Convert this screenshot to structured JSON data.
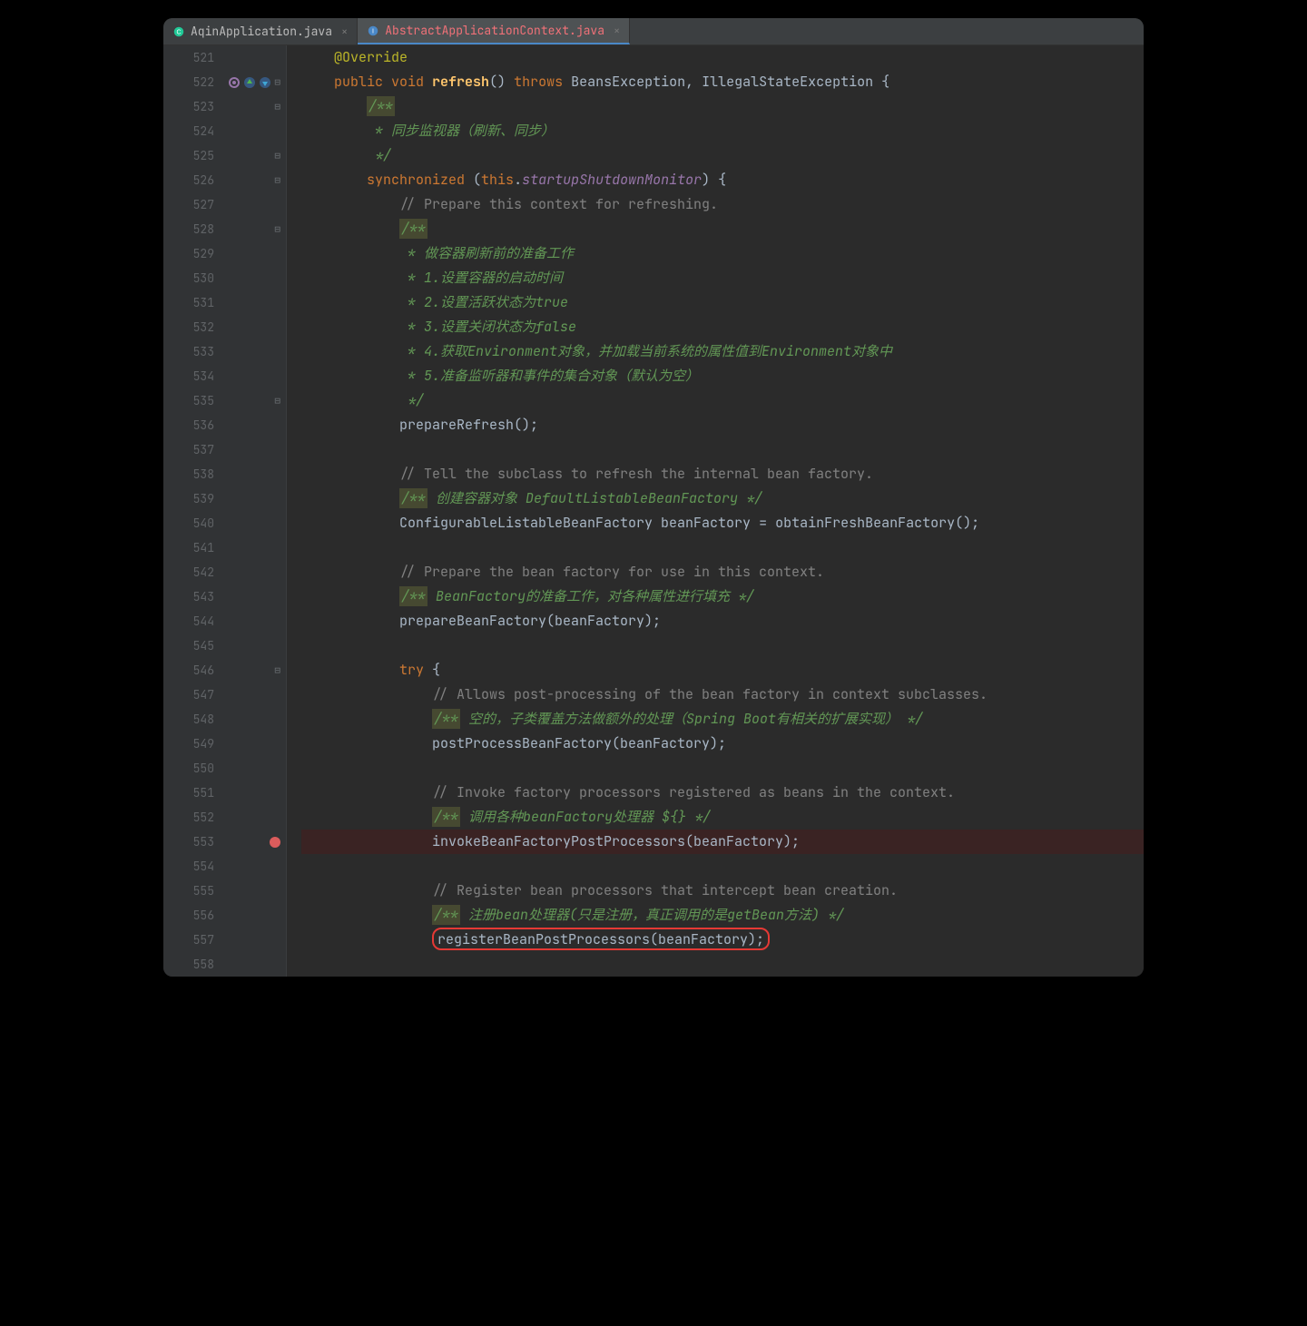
{
  "tabs": [
    {
      "file": "AqinApplication.java",
      "active": false,
      "iconColor": "#20c997"
    },
    {
      "file": "AbstractApplicationContext.java",
      "active": true,
      "iconColor": "#4a88c7"
    }
  ],
  "startLine": 521,
  "lines": [
    {
      "n": 521,
      "indent": 1,
      "t": "ann",
      "text": "@Override",
      "fold": ""
    },
    {
      "n": 522,
      "indent": 1,
      "t": "sig",
      "parts": {
        "kw1": "public",
        "kw2": "void",
        "name": "refresh",
        "throws": "throws",
        "e1": "BeansException",
        "e2": "IllegalStateException"
      },
      "gutterIcons": true,
      "fold": "⊟"
    },
    {
      "n": 523,
      "indent": 2,
      "t": "jdoc-hl",
      "text": "/**",
      "fold": "⊟"
    },
    {
      "n": 524,
      "indent": 2,
      "t": "jdoc",
      "text": " * 同步监视器（刷新、同步）"
    },
    {
      "n": 525,
      "indent": 2,
      "t": "jdoc",
      "text": " */",
      "fold": "⊟"
    },
    {
      "n": 526,
      "indent": 2,
      "t": "sync",
      "parts": {
        "kw": "synchronized",
        "this": "this",
        "mon": "startupShutdownMonitor"
      },
      "fold": "⊟"
    },
    {
      "n": 527,
      "indent": 3,
      "t": "com",
      "text": "// Prepare this context for refreshing."
    },
    {
      "n": 528,
      "indent": 3,
      "t": "jdoc-hl",
      "text": "/**",
      "fold": "⊟"
    },
    {
      "n": 529,
      "indent": 3,
      "t": "jdoc",
      "text": " * 做容器刷新前的准备工作"
    },
    {
      "n": 530,
      "indent": 3,
      "t": "jdoc",
      "text": " * 1.设置容器的启动时间"
    },
    {
      "n": 531,
      "indent": 3,
      "t": "jdoc",
      "text": " * 2.设置活跃状态为true"
    },
    {
      "n": 532,
      "indent": 3,
      "t": "jdoc",
      "text": " * 3.设置关闭状态为false"
    },
    {
      "n": 533,
      "indent": 3,
      "t": "jdoc",
      "text": " * 4.获取Environment对象，并加载当前系统的属性值到Environment对象中"
    },
    {
      "n": 534,
      "indent": 3,
      "t": "jdoc",
      "text": " * 5.准备监听器和事件的集合对象（默认为空）"
    },
    {
      "n": 535,
      "indent": 3,
      "t": "jdoc",
      "text": " */",
      "fold": "⊟"
    },
    {
      "n": 536,
      "indent": 3,
      "t": "call",
      "parts": {
        "name": "prepareRefresh",
        "args": ""
      }
    },
    {
      "n": 537,
      "indent": 3,
      "t": "blank",
      "text": ""
    },
    {
      "n": 538,
      "indent": 3,
      "t": "com",
      "text": "// Tell the subclass to refresh the internal bean factory."
    },
    {
      "n": 539,
      "indent": 3,
      "t": "jdoc-inline",
      "text": " 创建容器对象 DefaultListableBeanFactory "
    },
    {
      "n": 540,
      "indent": 3,
      "t": "decl",
      "parts": {
        "type": "ConfigurableListableBeanFactory",
        "var": "beanFactory",
        "rhs": "obtainFreshBeanFactory"
      }
    },
    {
      "n": 541,
      "indent": 3,
      "t": "blank",
      "text": ""
    },
    {
      "n": 542,
      "indent": 3,
      "t": "com",
      "text": "// Prepare the bean factory for use in this context."
    },
    {
      "n": 543,
      "indent": 3,
      "t": "jdoc-inline",
      "text": " BeanFactory的准备工作，对各种属性进行填充 "
    },
    {
      "n": 544,
      "indent": 3,
      "t": "call",
      "parts": {
        "name": "prepareBeanFactory",
        "args": "beanFactory"
      }
    },
    {
      "n": 545,
      "indent": 3,
      "t": "blank",
      "text": ""
    },
    {
      "n": 546,
      "indent": 3,
      "t": "try",
      "text": "try",
      "fold": "⊟"
    },
    {
      "n": 547,
      "indent": 4,
      "t": "com",
      "text": "// Allows post-processing of the bean factory in context subclasses."
    },
    {
      "n": 548,
      "indent": 4,
      "t": "jdoc-inline",
      "text": " 空的，子类覆盖方法做额外的处理（Spring Boot有相关的扩展实现） "
    },
    {
      "n": 549,
      "indent": 4,
      "t": "call",
      "parts": {
        "name": "postProcessBeanFactory",
        "args": "beanFactory"
      }
    },
    {
      "n": 550,
      "indent": 4,
      "t": "blank",
      "text": ""
    },
    {
      "n": 551,
      "indent": 4,
      "t": "com",
      "text": "// Invoke factory processors registered as beans in the context."
    },
    {
      "n": 552,
      "indent": 4,
      "t": "jdoc-inline",
      "text": " 调用各种beanFactory处理器 ${} "
    },
    {
      "n": 553,
      "indent": 4,
      "t": "call",
      "parts": {
        "name": "invokeBeanFactoryPostProcessors",
        "args": "beanFactory"
      },
      "breakpoint": true
    },
    {
      "n": 554,
      "indent": 4,
      "t": "blank",
      "text": ""
    },
    {
      "n": 555,
      "indent": 4,
      "t": "com",
      "text": "// Register bean processors that intercept bean creation."
    },
    {
      "n": 556,
      "indent": 4,
      "t": "jdoc-inline",
      "text": " 注册bean处理器(只是注册，真正调用的是getBean方法) "
    },
    {
      "n": 557,
      "indent": 4,
      "t": "call",
      "parts": {
        "name": "registerBeanPostProcessors",
        "args": "beanFactory"
      },
      "redbox": true
    },
    {
      "n": 558,
      "indent": 4,
      "t": "blank",
      "text": ""
    }
  ]
}
